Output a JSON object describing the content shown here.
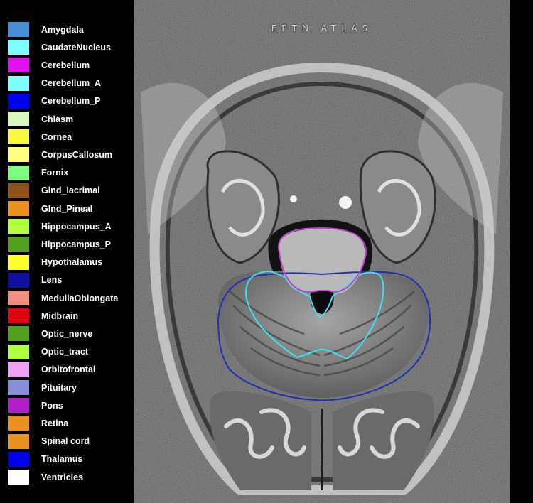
{
  "viewer": {
    "title": "EPTN ATLAS",
    "image": "axial brain MRI slice with contoured structures",
    "contour_colors": {
      "cerebellum": "#c040d0",
      "cerebellum_a": "#40e0f0",
      "cerebellum_p": "#2030b0"
    }
  },
  "legend": {
    "items": [
      {
        "label": "Amygdala",
        "color": "#4a90d9"
      },
      {
        "label": "CaudateNucleus",
        "color": "#80ffff"
      },
      {
        "label": "Cerebellum",
        "color": "#e010f0"
      },
      {
        "label": "Cerebellum_A",
        "color": "#80ffff"
      },
      {
        "label": "Cerebellum_P",
        "color": "#0000f0"
      },
      {
        "label": "Chiasm",
        "color": "#d8f8c0"
      },
      {
        "label": "Cornea",
        "color": "#f8f840"
      },
      {
        "label": "CorpusCallosum",
        "color": "#ffff80"
      },
      {
        "label": "Fornix",
        "color": "#80ff80"
      },
      {
        "label": "Glnd_lacrimal",
        "color": "#90521a"
      },
      {
        "label": "Glnd_Pineal",
        "color": "#e89020"
      },
      {
        "label": "Hippocampus_A",
        "color": "#b0ff40"
      },
      {
        "label": "Hippocampus_P",
        "color": "#50a020"
      },
      {
        "label": "Hypothalamus",
        "color": "#ffff30"
      },
      {
        "label": "Lens",
        "color": "#1010a0"
      },
      {
        "label": "MedullaOblongata",
        "color": "#f09080"
      },
      {
        "label": "Midbrain",
        "color": "#e00010"
      },
      {
        "label": "Optic_nerve",
        "color": "#50a020"
      },
      {
        "label": "Optic_tract",
        "color": "#b0ff40"
      },
      {
        "label": "Orbitofrontal",
        "color": "#f0a0f0"
      },
      {
        "label": "Pituitary",
        "color": "#8890d8"
      },
      {
        "label": "Pons",
        "color": "#b020c8"
      },
      {
        "label": "Retina",
        "color": "#e89020"
      },
      {
        "label": "Spinal cord",
        "color": "#e89020"
      },
      {
        "label": "Thalamus",
        "color": "#0000f0"
      },
      {
        "label": "Ventricles",
        "color": "#ffffff"
      }
    ]
  }
}
